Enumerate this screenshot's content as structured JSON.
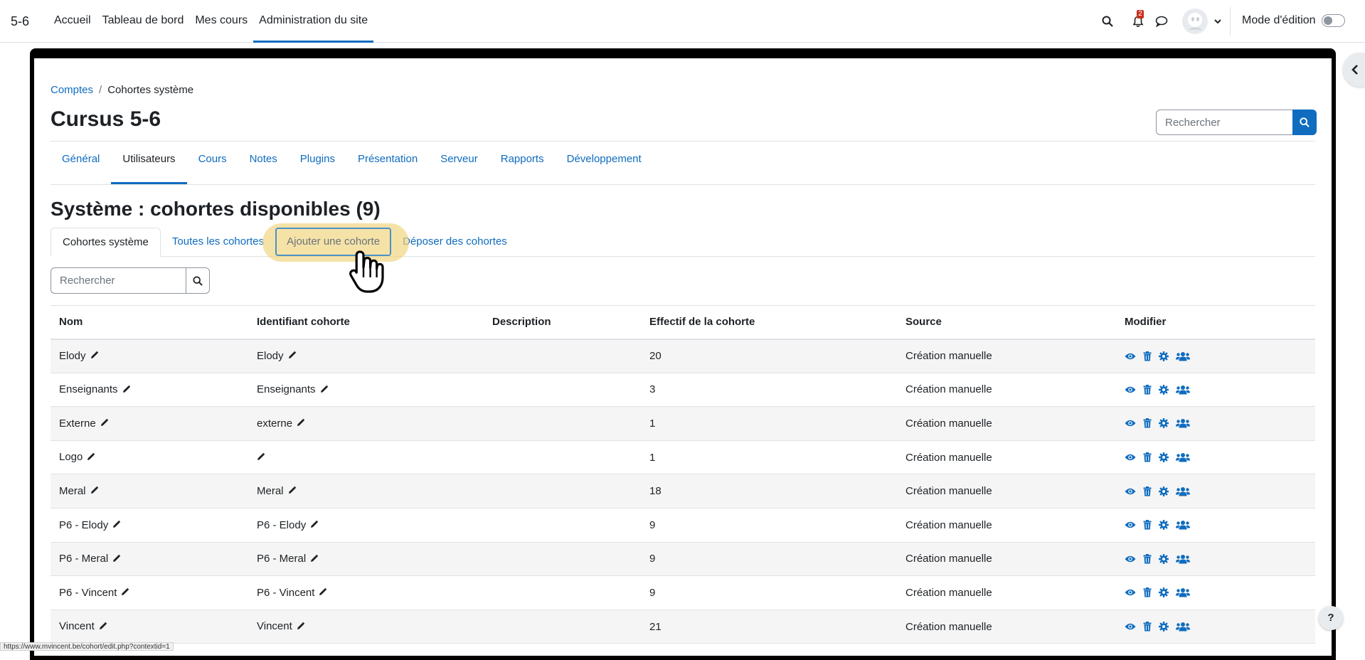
{
  "navbar": {
    "brand": "5-6",
    "links": [
      "Accueil",
      "Tableau de bord",
      "Mes cours",
      "Administration du site"
    ],
    "notification_count": "2",
    "edit_mode_label": "Mode d'édition"
  },
  "breadcrumb": {
    "parent": "Comptes",
    "separator": "/",
    "current": "Cohortes système"
  },
  "page_title": "Cursus 5-6",
  "top_search": {
    "placeholder": "Rechercher"
  },
  "secondary_nav": [
    "Général",
    "Utilisateurs",
    "Cours",
    "Notes",
    "Plugins",
    "Présentation",
    "Serveur",
    "Rapports",
    "Développement"
  ],
  "heading": "Système : cohortes disponibles (9)",
  "tabs": [
    "Cohortes système",
    "Toutes les cohortes",
    "Ajouter une cohorte",
    "Déposer des cohortes"
  ],
  "filter": {
    "placeholder": "Rechercher"
  },
  "table": {
    "headers": [
      "Nom",
      "Identifiant cohorte",
      "Description",
      "Effectif de la cohorte",
      "Source",
      "Modifier"
    ],
    "rows": [
      {
        "name": "Elody",
        "idnumber": "Elody",
        "description": "",
        "size": "20",
        "source": "Création manuelle"
      },
      {
        "name": "Enseignants",
        "idnumber": "Enseignants",
        "description": "",
        "size": "3",
        "source": "Création manuelle"
      },
      {
        "name": "Externe",
        "idnumber": "externe",
        "description": "",
        "size": "1",
        "source": "Création manuelle"
      },
      {
        "name": "Logo",
        "idnumber": "",
        "description": "",
        "size": "1",
        "source": "Création manuelle"
      },
      {
        "name": "Meral",
        "idnumber": "Meral",
        "description": "",
        "size": "18",
        "source": "Création manuelle"
      },
      {
        "name": "P6 - Elody",
        "idnumber": "P6 - Elody",
        "description": "",
        "size": "9",
        "source": "Création manuelle"
      },
      {
        "name": "P6 - Meral",
        "idnumber": "P6 - Meral",
        "description": "",
        "size": "9",
        "source": "Création manuelle"
      },
      {
        "name": "P6 - Vincent",
        "idnumber": "P6 - Vincent",
        "description": "",
        "size": "9",
        "source": "Création manuelle"
      },
      {
        "name": "Vincent",
        "idnumber": "Vincent",
        "description": "",
        "size": "21",
        "source": "Création manuelle"
      }
    ],
    "action_icons": [
      "eye-icon",
      "trash-icon",
      "gear-icon",
      "users-icon"
    ]
  },
  "status_url": "https://www.mvincent.be/cohort/edit.php?contextid=1",
  "help_label": "?",
  "colors": {
    "primary": "#0f6cbf",
    "text": "#1d2125",
    "highlight": "#f0d278"
  }
}
